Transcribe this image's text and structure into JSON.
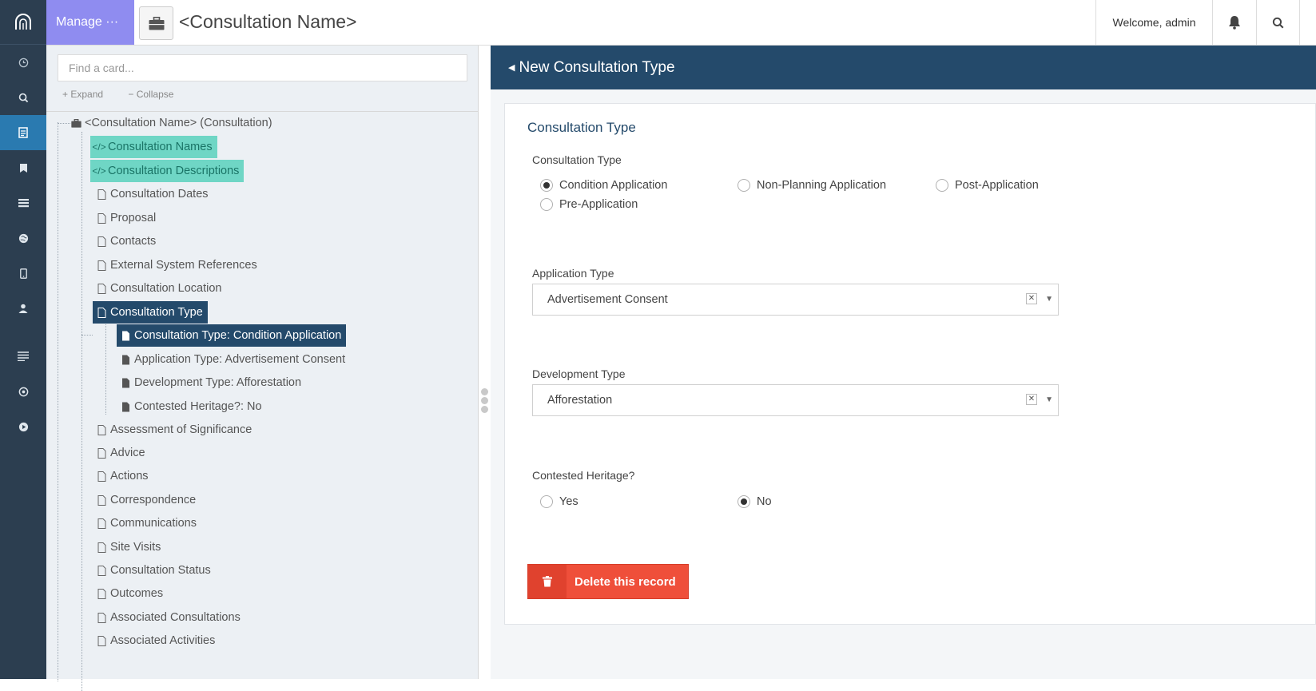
{
  "header": {
    "manage_label": "Manage ···",
    "title": "<Consultation Name>",
    "welcome": "Welcome, admin"
  },
  "rail": {
    "icons": [
      "logo-icon",
      "clock-icon",
      "search-icon",
      "file-icon",
      "bookmark-icon",
      "list-icon",
      "globe-icon",
      "mobile-icon",
      "user-icon",
      "lines-icon",
      "target-icon",
      "play-icon"
    ]
  },
  "tree": {
    "search_placeholder": "Find a card...",
    "expand_label": "Expand",
    "collapse_label": "Collapse",
    "root": "<Consultation Name> (Consultation)",
    "items": [
      "Consultation Names",
      "Consultation Descriptions",
      "Consultation Dates",
      "Proposal",
      "Contacts",
      "External System References",
      "Consultation Location",
      "Consultation Type",
      "Consultation Type: Condition Application",
      "Application Type: Advertisement Consent",
      "Development Type: Afforestation",
      "Contested Heritage?: No",
      "Assessment of Significance",
      "Advice",
      "Actions",
      "Correspondence",
      "Communications",
      "Site Visits",
      "Consultation Status",
      "Outcomes",
      "Associated Consultations",
      "Associated Activities"
    ]
  },
  "main": {
    "header_title": "New Consultation Type",
    "card_title": "Consultation Type",
    "consultation_type": {
      "label": "Consultation Type",
      "options": [
        "Condition Application",
        "Non-Planning Application",
        "Post-Application",
        "Pre-Application"
      ],
      "selected": "Condition Application"
    },
    "application_type": {
      "label": "Application Type",
      "value": "Advertisement Consent"
    },
    "development_type": {
      "label": "Development Type",
      "value": "Afforestation"
    },
    "contested_heritage": {
      "label": "Contested Heritage?",
      "options": [
        "Yes",
        "No"
      ],
      "selected": "No"
    },
    "delete_label": "Delete this record"
  },
  "colors": {
    "rail_bg": "#2c3e50",
    "manage_bg": "#8f8cf0",
    "header_dark": "#244a6b",
    "teal": "#6fd6c5",
    "danger": "#ef4f3a"
  }
}
